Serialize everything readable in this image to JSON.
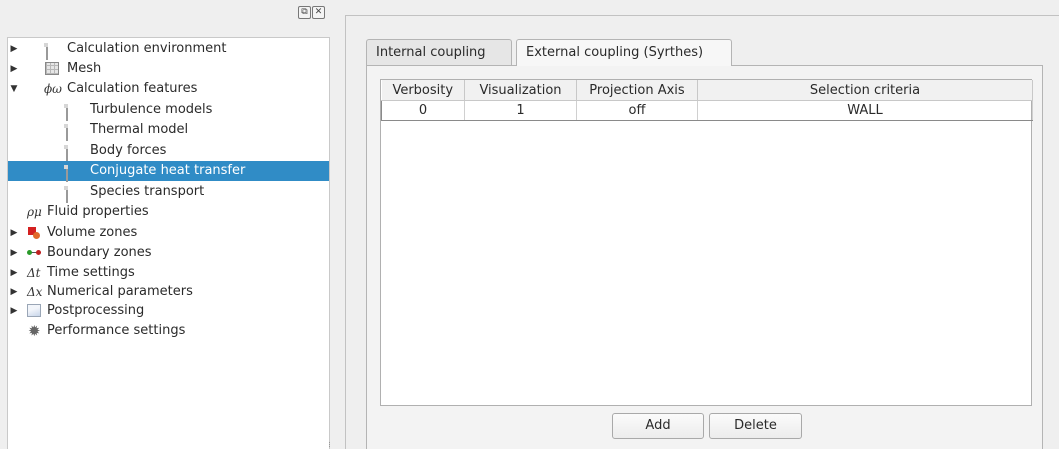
{
  "dock": {
    "float_glyph": "⧉",
    "close_glyph": "✕"
  },
  "tree": {
    "items": [
      {
        "label": "Calculation environment",
        "arrow": "▶",
        "icon": "document-icon"
      },
      {
        "label": "Mesh",
        "arrow": "▶",
        "icon": "mesh-grid-icon"
      },
      {
        "label": "Calculation features",
        "arrow": "▼",
        "icon": "phi-omega-icon",
        "icon_text": "ϕω"
      },
      {
        "label": "Turbulence models",
        "icon": "document-icon"
      },
      {
        "label": "Thermal model",
        "icon": "document-icon"
      },
      {
        "label": "Body forces",
        "icon": "document-icon"
      },
      {
        "label": "Conjugate heat transfer",
        "icon": "document-icon",
        "selected": true
      },
      {
        "label": "Species transport",
        "icon": "document-icon"
      },
      {
        "label": "Fluid properties",
        "icon": "rho-mu-icon",
        "icon_text": "ρμ"
      },
      {
        "label": "Volume zones",
        "arrow": "▶",
        "icon": "volume-zones-icon"
      },
      {
        "label": "Boundary zones",
        "arrow": "▶",
        "icon": "boundary-zones-icon"
      },
      {
        "label": "Time settings",
        "arrow": "▶",
        "icon": "delta-t-icon",
        "icon_text": "Δt"
      },
      {
        "label": "Numerical parameters",
        "arrow": "▶",
        "icon": "delta-x-icon",
        "icon_text": "Δx"
      },
      {
        "label": "Postprocessing",
        "arrow": "▶",
        "icon": "postprocessing-icon"
      },
      {
        "label": "Performance settings",
        "icon": "gear-icon"
      }
    ]
  },
  "tabs": [
    {
      "label": "Internal coupling",
      "active": false
    },
    {
      "label": "External coupling (Syrthes)",
      "active": true
    }
  ],
  "table": {
    "headers": [
      "Verbosity",
      "Visualization",
      "Projection Axis",
      "Selection criteria"
    ],
    "rows": [
      [
        "0",
        "1",
        "off",
        "WALL"
      ]
    ]
  },
  "buttons": {
    "add_label": "Add",
    "delete_label": "Delete"
  },
  "colors": {
    "selection": "#308cc6",
    "selection_text": "#ffffff"
  }
}
